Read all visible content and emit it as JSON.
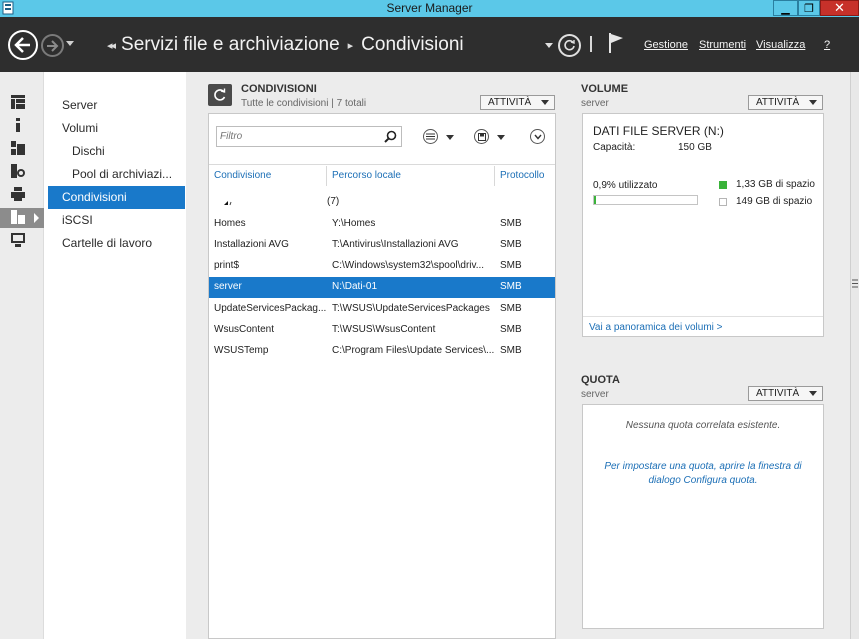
{
  "window": {
    "title": "Server Manager",
    "controls": {
      "minimize": "▁",
      "maximize": "❐",
      "close": "✕"
    }
  },
  "header": {
    "breadcrumb_lead": "◂◂",
    "breadcrumb": [
      "Servizi file e archiviazione",
      "Condivisioni"
    ],
    "menus": [
      "Gestione",
      "Strumenti",
      "Visualizza",
      "?"
    ]
  },
  "nav": {
    "items": [
      {
        "label": "Server"
      },
      {
        "label": "Volumi"
      },
      {
        "label": "Dischi"
      },
      {
        "label": "Pool di archiviazi..."
      },
      {
        "label": "Condivisioni"
      },
      {
        "label": "iSCSI"
      },
      {
        "label": "Cartelle di lavoro"
      }
    ],
    "active_index": 4
  },
  "shares": {
    "title": "CONDIVISIONI",
    "subtitle": "Tutte le condivisioni | 7 totali",
    "tasks_label": "ATTIVITÀ",
    "filter_placeholder": "Filtro",
    "columns": [
      "Condivisione",
      "Percorso locale",
      "Protocollo"
    ],
    "group_label": "(7)",
    "rows": [
      {
        "name": "Homes",
        "path": "Y:\\Homes",
        "protocol": "SMB"
      },
      {
        "name": "Installazioni AVG",
        "path": "T:\\Antivirus\\Installazioni AVG",
        "protocol": "SMB"
      },
      {
        "name": "print$",
        "path": "C:\\Windows\\system32\\spool\\driv...",
        "protocol": "SMB"
      },
      {
        "name": "server",
        "path": "N:\\Dati-01",
        "protocol": "SMB"
      },
      {
        "name": "UpdateServicesPackag...",
        "path": "T:\\WSUS\\UpdateServicesPackages",
        "protocol": "SMB"
      },
      {
        "name": "WsusContent",
        "path": "T:\\WSUS\\WsusContent",
        "protocol": "SMB"
      },
      {
        "name": "WSUSTemp",
        "path": "C:\\Program Files\\Update Services\\...",
        "protocol": "SMB"
      }
    ],
    "selected_index": 3
  },
  "volume": {
    "title": "VOLUME",
    "subtitle": "server",
    "tasks_label": "ATTIVITÀ",
    "name": "DATI FILE SERVER (N:)",
    "capacity_label": "Capacità:",
    "capacity_value": "150 GB",
    "used_label": "0,9% utilizzato",
    "used_fraction": 0.009,
    "legend_used": "1,33 GB di spazio",
    "legend_free": "149 GB di spazio",
    "link": "Vai a panoramica dei volumi >",
    "used_color": "#3ab33a"
  },
  "quota": {
    "title": "QUOTA",
    "subtitle": "server",
    "tasks_label": "ATTIVITÀ",
    "empty_message": "Nessuna quota correlata esistente.",
    "help_line1": "Per impostare una quota, aprire la finestra di",
    "help_line2": "dialogo Configura quota."
  }
}
